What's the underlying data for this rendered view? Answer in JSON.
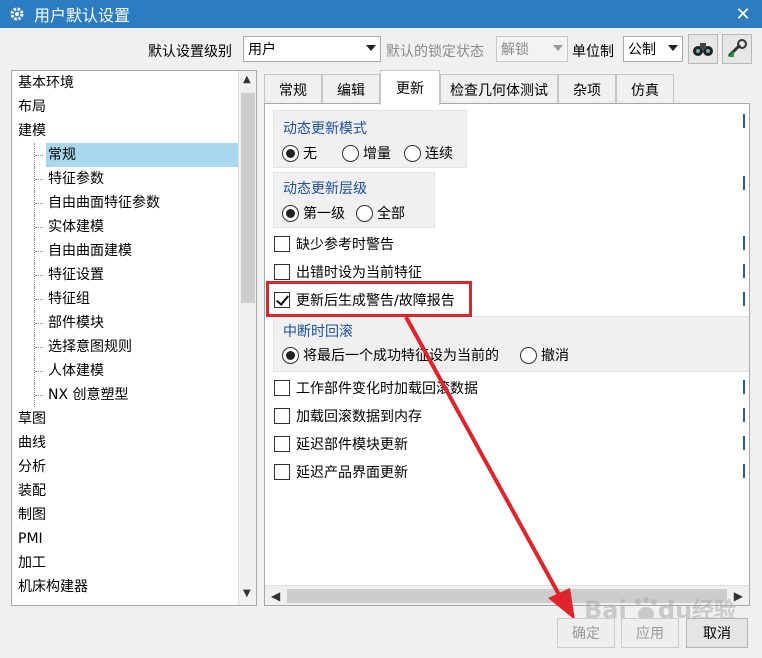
{
  "window": {
    "title": "用户默认设置",
    "close_glyph": "✕"
  },
  "toolbar": {
    "level_label": "默认设置级别",
    "level_value": "用户",
    "lock_label": "默认的锁定状态",
    "lock_value": "解锁",
    "unit_label": "单位制",
    "unit_value": "公制"
  },
  "tree": {
    "items": [
      {
        "label": "基本环境",
        "level": 1
      },
      {
        "label": "布局",
        "level": 1
      },
      {
        "label": "建模",
        "level": 1
      },
      {
        "label": "常规",
        "level": 2,
        "selected": true
      },
      {
        "label": "特征参数",
        "level": 2
      },
      {
        "label": "自由曲面特征参数",
        "level": 2
      },
      {
        "label": "实体建模",
        "level": 2
      },
      {
        "label": "自由曲面建模",
        "level": 2
      },
      {
        "label": "特征设置",
        "level": 2
      },
      {
        "label": "特征组",
        "level": 2
      },
      {
        "label": "部件模块",
        "level": 2
      },
      {
        "label": "选择意图规则",
        "level": 2
      },
      {
        "label": "人体建模",
        "level": 2
      },
      {
        "label": "NX 创意塑型",
        "level": 2
      },
      {
        "label": "草图",
        "level": 1
      },
      {
        "label": "曲线",
        "level": 1
      },
      {
        "label": "分析",
        "level": 1
      },
      {
        "label": "装配",
        "level": 1
      },
      {
        "label": "制图",
        "level": 1
      },
      {
        "label": "PMI",
        "level": 1
      },
      {
        "label": "加工",
        "level": 1
      },
      {
        "label": "机床构建器",
        "level": 1
      }
    ]
  },
  "tabs": [
    {
      "label": "常规"
    },
    {
      "label": "编辑"
    },
    {
      "label": "更新",
      "active": true
    },
    {
      "label": "检查几何体测试"
    },
    {
      "label": "杂项"
    },
    {
      "label": "仿真"
    }
  ],
  "panel": {
    "group1": {
      "title": "动态更新模式",
      "options": [
        "无",
        "增量",
        "连续"
      ],
      "selected": 0
    },
    "group2": {
      "title": "动态更新层级",
      "options": [
        "第一级",
        "全部"
      ],
      "selected": 0
    },
    "check_missing_ref": {
      "label": "缺少参考时警告",
      "checked": false
    },
    "check_error_current": {
      "label": "出错时设为当前特征",
      "checked": false
    },
    "check_alert_report": {
      "label": "更新后生成警告/故障报告",
      "checked": true
    },
    "group3": {
      "title": "中断时回滚",
      "options": [
        "将最后一个成功特征设为当前的",
        "撤消"
      ],
      "selected": 0
    },
    "check_load_rollback": {
      "label": "工作部件变化时加载回滚数据",
      "checked": false
    },
    "check_rollback_memory": {
      "label": "加载回滚数据到内存",
      "checked": false
    },
    "check_delay_module": {
      "label": "延迟部件模块更新",
      "checked": false
    },
    "check_delay_product": {
      "label": "延迟产品界面更新",
      "checked": false
    }
  },
  "buttons": {
    "ok": "确定",
    "apply": "应用",
    "cancel": "取消"
  },
  "colors": {
    "titlebar": "#2b7cc0",
    "selection": "#a8d8ee",
    "annotation": "#e0242c"
  }
}
